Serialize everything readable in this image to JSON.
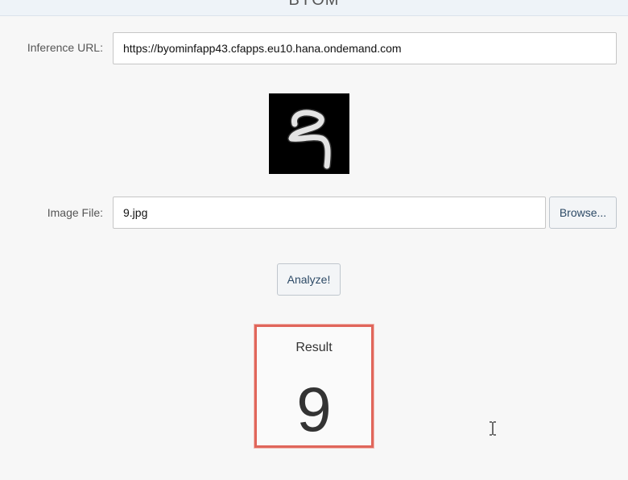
{
  "header": {
    "title": "BYOM"
  },
  "form": {
    "inference_url_label": "Inference URL:",
    "inference_url_value": "https://byominfapp43.cfapps.eu10.hana.ondemand.com",
    "image_file_label": "Image File:",
    "image_file_value": "9.jpg",
    "browse_label": "Browse...",
    "analyze_label": "Analyze!"
  },
  "preview": {
    "description_icon": "digit-image",
    "background_color": "#000000",
    "stroke_color": "#ffffff"
  },
  "result": {
    "title": "Result",
    "value": "9",
    "border_color": "#e0665b"
  }
}
